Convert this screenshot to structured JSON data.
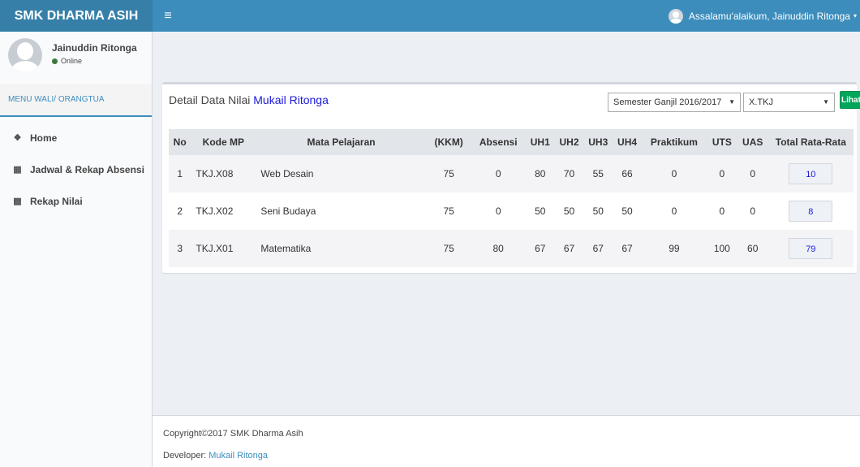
{
  "header": {
    "logo": "SMK DHARMA ASIH",
    "menu_toggle": "≡",
    "greeting": "Assalamu'alaikum, Jainuddin Ritonga"
  },
  "sidebar": {
    "user_name": "Jainuddin Ritonga",
    "status": "Online",
    "menu_title": "MENU WALI/ ORANGTUA",
    "items": [
      {
        "label": "Home",
        "icon": "home-icon"
      },
      {
        "label": "Jadwal & Rekap Absensi",
        "icon": "calendar-icon"
      },
      {
        "label": "Rekap Nilai",
        "icon": "grid-icon"
      }
    ]
  },
  "box": {
    "title_prefix": "Detail Data Nilai ",
    "student_name": "Mukail Ritonga",
    "semester": "Semester Ganjil 2016/2017",
    "class": "X.TKJ",
    "button": "Lihat"
  },
  "table": {
    "headers": [
      "No",
      "Kode MP",
      "Mata Pelajaran",
      "(KKM)",
      "Absensi",
      "UH1",
      "UH2",
      "UH3",
      "UH4",
      "Praktikum",
      "UTS",
      "UAS",
      "Total Rata-Rata"
    ],
    "rows": [
      [
        "1",
        "TKJ.X08",
        "Web Desain",
        "75",
        "0",
        "80",
        "70",
        "55",
        "66",
        "0",
        "0",
        "0",
        "10"
      ],
      [
        "2",
        "TKJ.X02",
        "Seni Budaya",
        "75",
        "0",
        "50",
        "50",
        "50",
        "50",
        "0",
        "0",
        "0",
        "8"
      ],
      [
        "3",
        "TKJ.X01",
        "Matematika",
        "75",
        "80",
        "67",
        "67",
        "67",
        "67",
        "99",
        "100",
        "60",
        "79"
      ]
    ]
  },
  "footer": {
    "copyright": "Copyright©2017 SMK Dharma Asih",
    "developer_label": "Developer: ",
    "developer_name": "Mukail Ritonga"
  }
}
